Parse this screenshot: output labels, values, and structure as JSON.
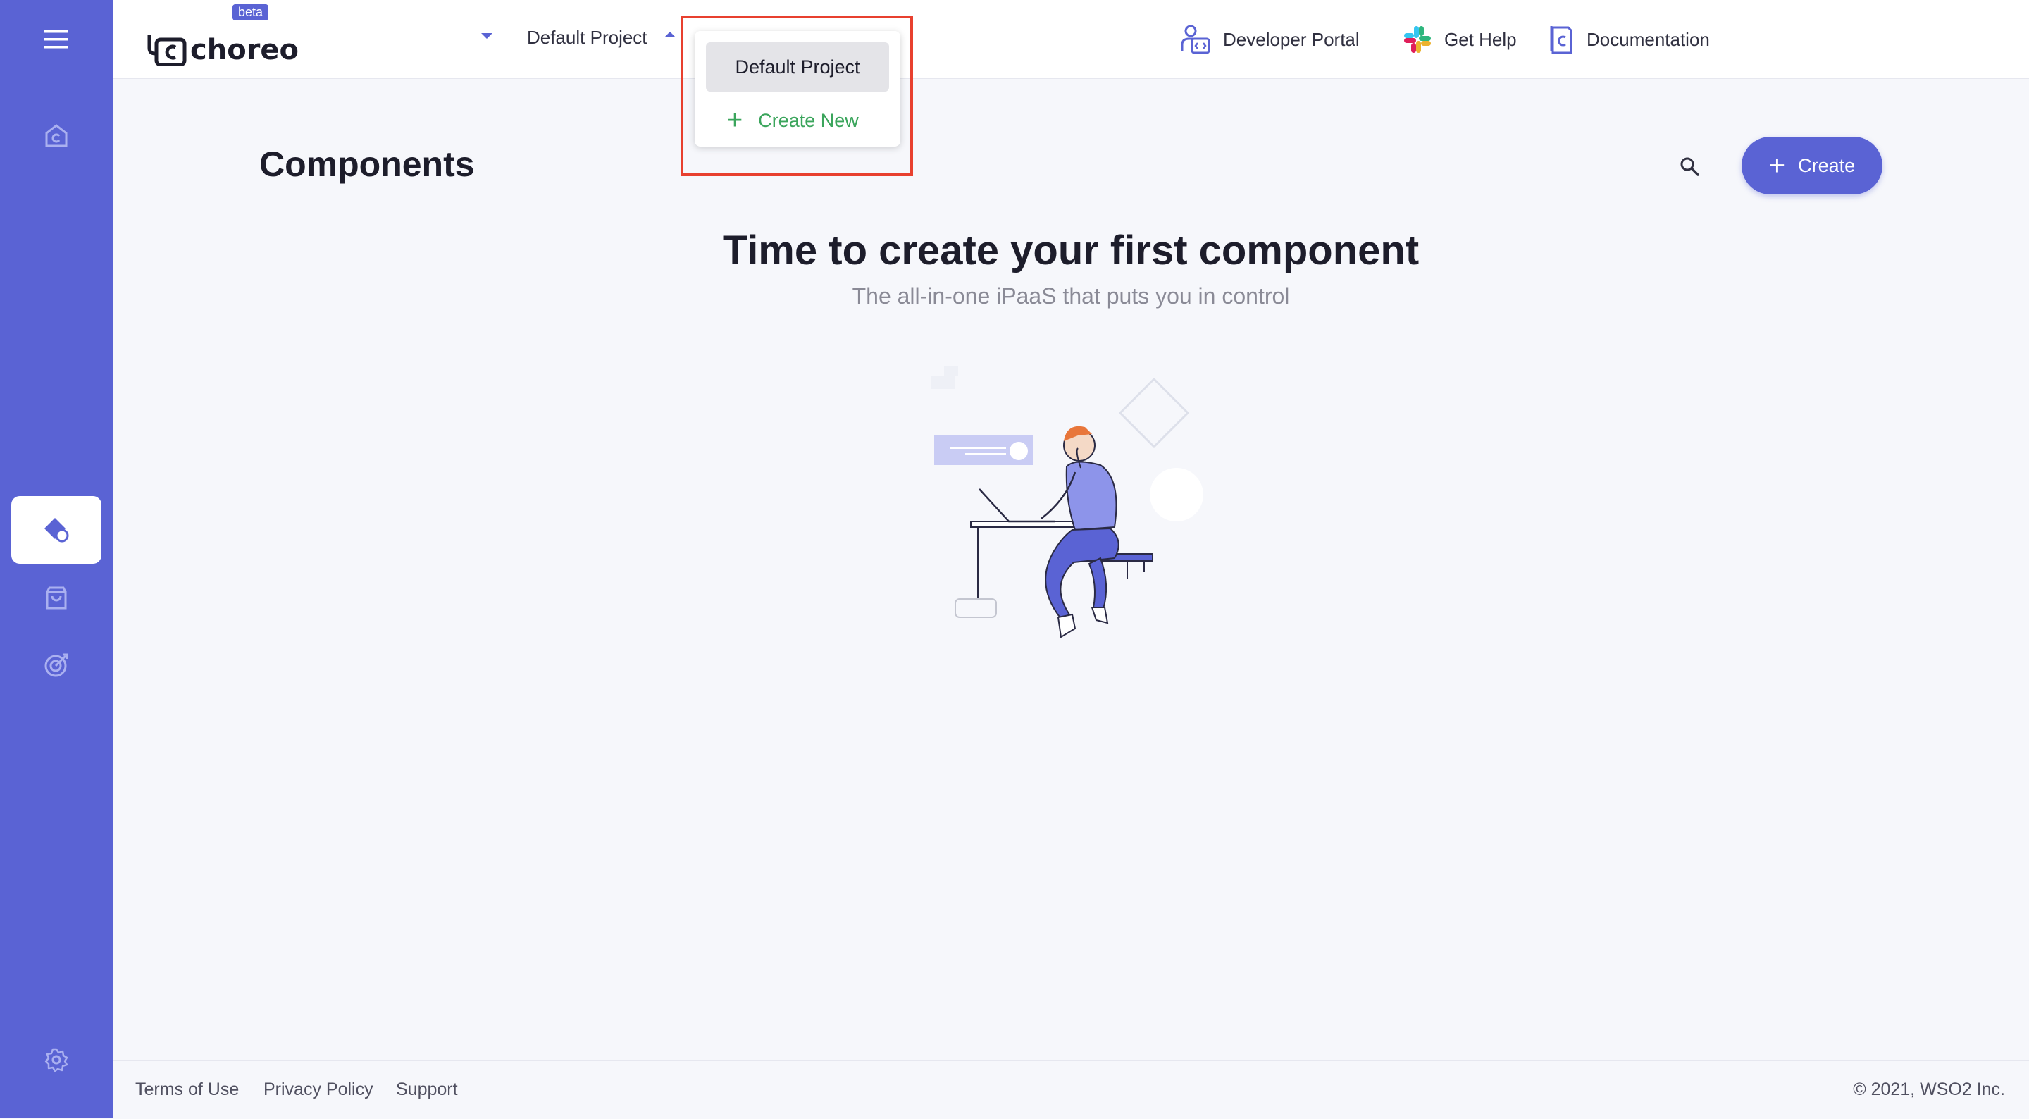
{
  "app": {
    "logo_text": "choreo",
    "beta_badge": "beta"
  },
  "header": {
    "project_selector": {
      "value": "Default Project"
    },
    "links": {
      "developer_portal": "Developer Portal",
      "get_help": "Get Help",
      "documentation": "Documentation"
    }
  },
  "project_menu": {
    "items": [
      {
        "label": "Default Project",
        "selected": true
      },
      {
        "label": "Create New",
        "icon": "plus-icon"
      }
    ]
  },
  "sidebar": {
    "items": [
      {
        "icon": "menu-icon"
      },
      {
        "icon": "home-icon"
      },
      {
        "icon": "components-icon",
        "active": true
      },
      {
        "icon": "marketplace-icon"
      },
      {
        "icon": "observability-icon"
      },
      {
        "icon": "settings-icon"
      }
    ]
  },
  "main": {
    "title": "Components",
    "create_button": "Create",
    "empty_state": {
      "title": "Time to create your first component",
      "subtitle": "The all-in-one iPaaS that puts you in control"
    }
  },
  "footer": {
    "links": [
      "Terms of Use",
      "Privacy Policy",
      "Support"
    ],
    "copyright": "©  2021, WSO2 Inc."
  },
  "colors": {
    "brand": "#5a63d4",
    "success": "#3ba55c",
    "highlight": "#e8402f",
    "background": "#f6f7fb"
  }
}
